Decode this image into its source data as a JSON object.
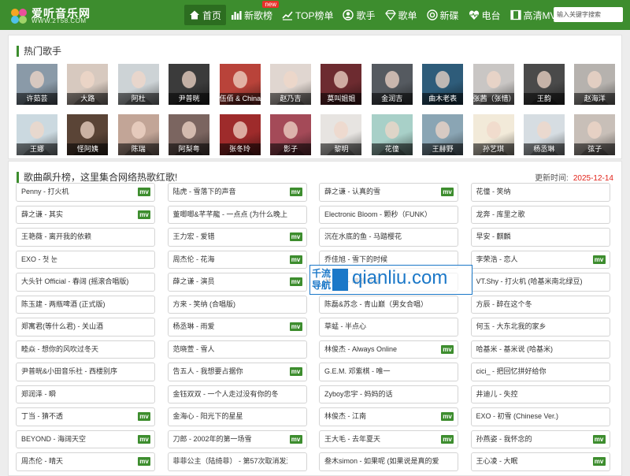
{
  "site": {
    "name": "爱听音乐网",
    "url": "WWW.2T58.COM"
  },
  "nav": [
    {
      "label": "首页",
      "icon": "home-icon",
      "active": true
    },
    {
      "label": "新歌榜",
      "icon": "bar-chart-icon",
      "badge": "new"
    },
    {
      "label": "TOP榜单",
      "icon": "trend-icon"
    },
    {
      "label": "歌手",
      "icon": "user-icon"
    },
    {
      "label": "歌单",
      "icon": "diamond-icon"
    },
    {
      "label": "新碟",
      "icon": "disc-icon"
    },
    {
      "label": "电台",
      "icon": "heart-pulse-icon"
    },
    {
      "label": "高清MV",
      "icon": "film-icon"
    }
  ],
  "search": {
    "placeholder": "输入关键字搜索"
  },
  "singers_section": {
    "title": "热门歌手",
    "singers": [
      {
        "name": "许茹芸",
        "color": "#8a9aa8"
      },
      {
        "name": "大路",
        "color": "#d7c9bf"
      },
      {
        "name": "阿杜",
        "color": "#cdd3d6"
      },
      {
        "name": "尹普晄",
        "color": "#3b3b3b"
      },
      {
        "name": "伍佰 & China Blue",
        "color": "#b9433a"
      },
      {
        "name": "赵乃吉",
        "color": "#e0d6d0"
      },
      {
        "name": "莫叫姐姐",
        "color": "#6d2b30"
      },
      {
        "name": "金润吉",
        "color": "#555a60"
      },
      {
        "name": "曲木老表",
        "color": "#2e5c7a"
      },
      {
        "name": "张茜（张惜）",
        "color": "#c9c6c4"
      },
      {
        "name": "王韵",
        "color": "#4a4a4a"
      },
      {
        "name": "赵海洋",
        "color": "#b6b2ae"
      },
      {
        "name": "王娜",
        "color": "#cbd9e0"
      },
      {
        "name": "怪阿姨",
        "color": "#5a4436"
      },
      {
        "name": "陈瑞",
        "color": "#c2a597"
      },
      {
        "name": "阿梨粤",
        "color": "#7b6560"
      },
      {
        "name": "张冬玲",
        "color": "#9e2b2b"
      },
      {
        "name": "影子",
        "color": "#a44a58"
      },
      {
        "name": "黎明",
        "color": "#e7e4e1"
      },
      {
        "name": "花僮",
        "color": "#a8d0c8"
      },
      {
        "name": "王赫野",
        "color": "#8aa5b4"
      },
      {
        "name": "孙艺琪",
        "color": "#f2ead9"
      },
      {
        "name": "杨丞琳",
        "color": "#d6dde2"
      },
      {
        "name": "弦子",
        "color": "#c8bfb8"
      }
    ]
  },
  "songs_section": {
    "title": "歌曲飙升榜，这里集合网络热歌红歌!",
    "update_label": "更新时间:",
    "update_date": "2025-12-14",
    "mv_label": "mv",
    "songs": [
      {
        "title": "Penny - 打火机",
        "mv": true
      },
      {
        "title": "陆虎 - 雪落下的声音",
        "mv": true
      },
      {
        "title": "薛之谦 - 认真的雪",
        "mv": true
      },
      {
        "title": "花僮 - 笑纳",
        "mv": false
      },
      {
        "title": "薛之谦 - 其实",
        "mv": true
      },
      {
        "title": "董唧唧&芊芊龍 - 一点点 (为什么晚上总",
        "mv": false
      },
      {
        "title": "Electronic Bloom - 颗秒（FUNK）",
        "mv": false
      },
      {
        "title": "龙奔 - 库里之歌",
        "mv": false
      },
      {
        "title": "王艳薇 - 离开我的依赖",
        "mv": false
      },
      {
        "title": "王力宏 - 爱错",
        "mv": true
      },
      {
        "title": "沉在水底的鱼 - 马踏樱花",
        "mv": false
      },
      {
        "title": "早安 - 麒麟",
        "mv": false
      },
      {
        "title": "EXO - 첫 눈",
        "mv": false
      },
      {
        "title": "周杰伦 - 花海",
        "mv": true
      },
      {
        "title": "乔佳旭 - 雪下的时候",
        "mv": false
      },
      {
        "title": "李荣浩 - 恋人",
        "mv": true
      },
      {
        "title": "大头针 Official - 春阔 (摇滚合唱版)",
        "mv": false
      },
      {
        "title": "薛之谦 - 演员",
        "mv": true
      },
      {
        "title": "林俊杰 - 晴朗书局",
        "mv": false
      },
      {
        "title": "VT.Shy - 打火机 (哈基米南北绿豆)",
        "mv": false
      },
      {
        "title": "陈玉建 - 两瓶啤酒 (正式版)",
        "mv": false
      },
      {
        "title": "方来 - 笑纳 (合唱版)",
        "mv": false
      },
      {
        "title": "陈磊&苏念 - 青山巅（男女合唱）",
        "mv": false
      },
      {
        "title": "方辰 - 醉在这个冬",
        "mv": false
      },
      {
        "title": "郑寓君(等什么君) - 关山酒",
        "mv": false
      },
      {
        "title": "杨丞琳 - 雨爱",
        "mv": true
      },
      {
        "title": "草蜢 - 半点心",
        "mv": false
      },
      {
        "title": "何玉 - 大东北我的家乡",
        "mv": false
      },
      {
        "title": "睦焱 - 想你的风吹过冬天",
        "mv": false
      },
      {
        "title": "范晓萱 - 雪人",
        "mv": false
      },
      {
        "title": "林俊杰 - Always Online",
        "mv": true
      },
      {
        "title": "哈基米 - 基米说 (哈基米)",
        "mv": false
      },
      {
        "title": "尹普晄&小田音乐社 - 西楼别序",
        "mv": false
      },
      {
        "title": "告五人 - 我想要占据你",
        "mv": true
      },
      {
        "title": "G.E.M. 邓紫棋 - 唯一",
        "mv": false
      },
      {
        "title": "cici_ - 把回忆拼好给你",
        "mv": false
      },
      {
        "title": "郑润泽 - 瞬",
        "mv": false
      },
      {
        "title": "金钰双双 - 一个人走过没有你的冬",
        "mv": false
      },
      {
        "title": "Zyboy忠宇 - 妈妈的话",
        "mv": false
      },
      {
        "title": "井迪儿 - 失控",
        "mv": false
      },
      {
        "title": "丁当 - 猜不透",
        "mv": true
      },
      {
        "title": "金海心 - 阳光下的星星",
        "mv": false
      },
      {
        "title": "林俊杰 - 江南",
        "mv": true
      },
      {
        "title": "EXO - 初雪 (Chinese Ver.)",
        "mv": false
      },
      {
        "title": "BEYOND - 海阔天空",
        "mv": true
      },
      {
        "title": "刀郎 - 2002年的第一场雪",
        "mv": true
      },
      {
        "title": "王大毛 - 去年夏天",
        "mv": true
      },
      {
        "title": "孙燕姿 - 我怀念的",
        "mv": true
      },
      {
        "title": "周杰伦 - 晴天",
        "mv": true
      },
      {
        "title": "菲菲公主（陆绮菲） - 第57次取消发送",
        "mv": false
      },
      {
        "title": "叁木simon - 如果呢 (如果说是真的爱",
        "mv": false
      },
      {
        "title": "王心凌 - 大眠",
        "mv": true
      }
    ]
  },
  "watermark": {
    "line1": "千流",
    "line2": "导航",
    "url": "qianliu.com"
  }
}
